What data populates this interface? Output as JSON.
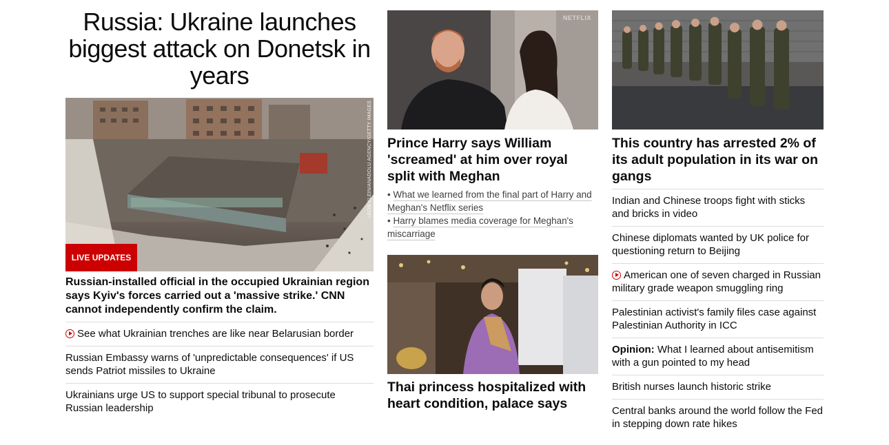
{
  "left": {
    "headline": "Russia: Ukraine launches biggest attack on Donetsk in years",
    "image_credit": "LEON KLEIN/ANADOLU AGENCY/GETTY IMAGES",
    "live_badge": "LIVE UPDATES",
    "caption": "Russian-installed official in the occupied Ukrainian region says Kyiv's forces carried out a 'massive strike.' CNN cannot independently confirm the claim.",
    "list": [
      {
        "text": "See what Ukrainian trenches are like near Belarusian border",
        "video": true
      },
      {
        "text": "Russian Embassy warns of 'unpredictable consequences' if US sends Patriot missiles to Ukraine",
        "video": false
      },
      {
        "text": "Ukrainians urge US to support special tribunal to prosecute Russian leadership",
        "video": false
      }
    ]
  },
  "middle": {
    "image1_mark": "NETFLIX",
    "headline1": "Prince Harry says William 'screamed' at him over royal split with Meghan",
    "related": [
      "What we learned from the final part of Harry and Meghan's Netflix series",
      "Harry blames media coverage for Meghan's miscarriage"
    ],
    "headline2": "Thai princess hospitalized with heart condition, palace says"
  },
  "right": {
    "headline": "This country has arrested 2% of its adult population in its war on gangs",
    "list": [
      {
        "label": "",
        "text": "Indian and Chinese troops fight with sticks and bricks in video",
        "video": false
      },
      {
        "label": "",
        "text": "Chinese diplomats wanted by UK police for questioning return to Beijing",
        "video": false
      },
      {
        "label": "",
        "text": "American one of seven charged in Russian military grade weapon smuggling ring",
        "video": true
      },
      {
        "label": "",
        "text": "Palestinian activist's family files case against Palestinian Authority in ICC",
        "video": false
      },
      {
        "label": "Opinion:",
        "text": "What I learned about antisemitism with a gun pointed to my head",
        "video": false
      },
      {
        "label": "",
        "text": "British nurses launch historic strike",
        "video": false
      },
      {
        "label": "",
        "text": "Central banks around the world follow the Fed in stepping down rate hikes",
        "video": false
      }
    ]
  },
  "colors": {
    "accent": "#cc0000",
    "text": "#0c0c0c",
    "divider": "#dcdcdc"
  }
}
